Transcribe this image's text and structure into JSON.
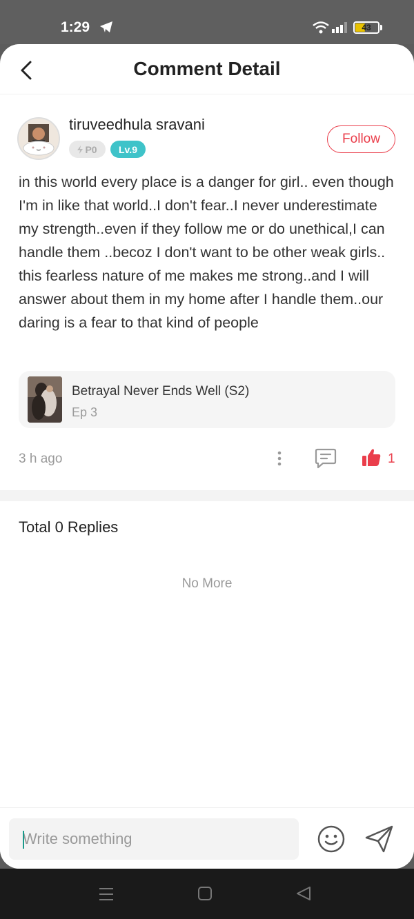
{
  "status_bar": {
    "time": "1:29",
    "battery": "43",
    "battery_level": 0.43
  },
  "header": {
    "title": "Comment Detail"
  },
  "comment": {
    "username": "tiruveedhula sravani",
    "badge_points": "P0",
    "badge_level": "Lv.9",
    "follow_label": "Follow",
    "text": "in this world every place is a danger for girl.. even though I'm in like that world..I don't fear..I never underestimate my strength..even if they follow me or do unethical,I can handle them ..becoz I don't want to be other weak girls.. this fearless nature of me makes me strong..and I will answer about them in my home after I handle them..our daring is a fear to that kind of people",
    "time_ago": "3 h ago",
    "like_count": "1"
  },
  "drama": {
    "title": "Betrayal Never Ends Well (S2)",
    "episode": "Ep 3"
  },
  "replies": {
    "title": "Total 0 Replies",
    "end_text": "No More"
  },
  "input": {
    "placeholder": "Write something"
  },
  "colors": {
    "accent": "#ea3e4b",
    "level_badge": "#3fc3c9"
  }
}
